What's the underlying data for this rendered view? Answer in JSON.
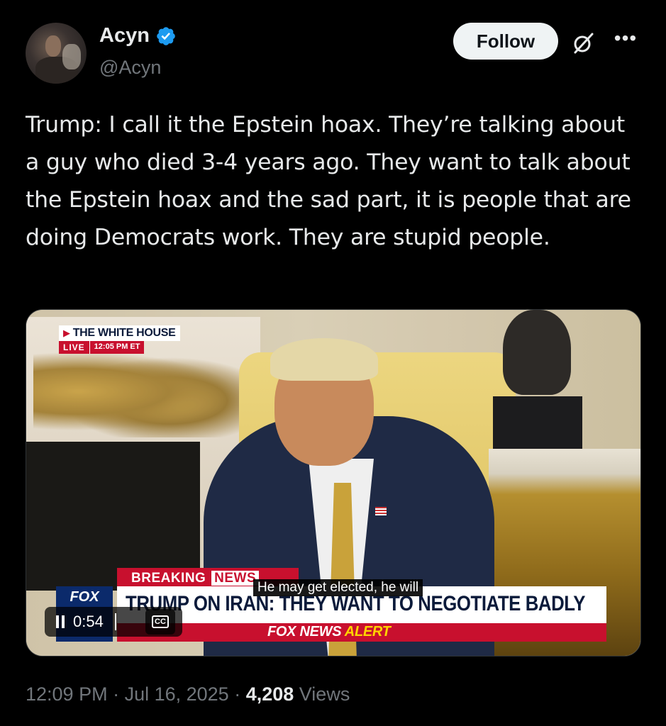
{
  "author": {
    "display_name": "Acyn",
    "handle": "@Acyn",
    "verified": true,
    "verified_color": "#1d9bf0"
  },
  "actions": {
    "follow_label": "Follow",
    "grok_icon": "grok-icon",
    "more_label": "•••"
  },
  "tweet": {
    "text": "Trump: I call it the Epstein hoax. They’re talking about a guy who died 3-4 years ago. They want to talk about the Epstein hoax and the sad part, it is people that are doing Democrats work. They are stupid people."
  },
  "video": {
    "bug_title": "THE WHITE HOUSE",
    "bug_live": "LIVE",
    "bug_time": "12:05 PM ET",
    "breaking_label": "BREAKING",
    "breaking_news": "NEWS",
    "headline": "TRUMP ON IRAN: THEY WANT TO NEGOTIATE BADLY",
    "alert_prefix": "FOX NEWS",
    "alert_suffix": "ALERT",
    "network_logo": "FOX",
    "caption": "He may get elected, he will",
    "elapsed": "0:54",
    "cc_label": "CC"
  },
  "meta": {
    "time": "12:09 PM",
    "sep1": " · ",
    "date": "Jul 16, 2025",
    "sep2": " · ",
    "views_count": "4,208",
    "views_label": " Views"
  },
  "colors": {
    "background": "#000000",
    "text_primary": "#e7e9ea",
    "text_secondary": "#71767b",
    "follow_bg": "#eff3f4",
    "fox_red": "#c8102e"
  }
}
